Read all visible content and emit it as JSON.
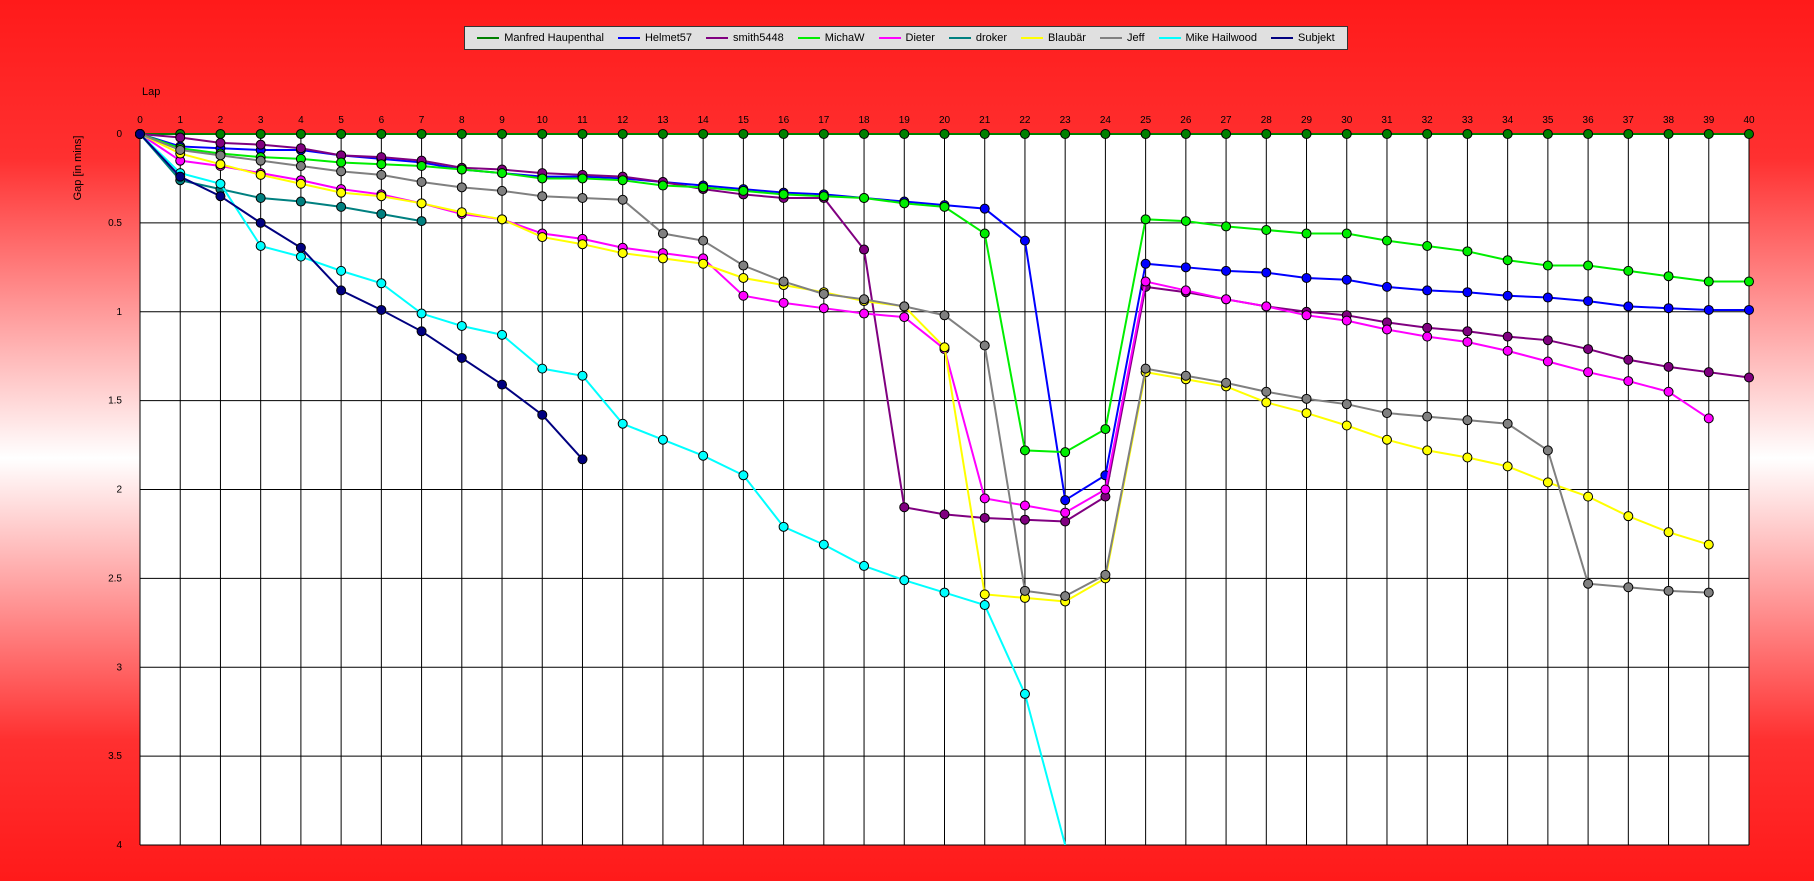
{
  "chart_data": {
    "type": "line",
    "xlabel": "Lap",
    "ylabel": "Gap [in mins]",
    "xlim": [
      0,
      40
    ],
    "ylim": [
      0,
      4
    ],
    "y_inverted": true,
    "grid": true,
    "legend_position": "top-center",
    "x": [
      0,
      1,
      2,
      3,
      4,
      5,
      6,
      7,
      8,
      9,
      10,
      11,
      12,
      13,
      14,
      15,
      16,
      17,
      18,
      19,
      20,
      21,
      22,
      23,
      24,
      25,
      26,
      27,
      28,
      29,
      30,
      31,
      32,
      33,
      34,
      35,
      36,
      37,
      38,
      39,
      40
    ],
    "y_ticks": [
      0,
      0.5,
      1,
      1.5,
      2,
      2.5,
      3,
      3.5,
      4
    ],
    "y_tick_labels": [
      "0",
      "0.5",
      "1",
      "1.5",
      "2",
      "2.5",
      "3",
      "3.5",
      "4"
    ],
    "series": [
      {
        "name": "Manfred Haupenthal",
        "color": "#008000",
        "values": [
          0,
          0,
          0,
          0,
          0,
          0,
          0,
          0,
          0,
          0,
          0,
          0,
          0,
          0,
          0,
          0,
          0,
          0,
          0,
          0,
          0,
          0,
          0,
          0,
          0,
          0,
          0,
          0,
          0,
          0,
          0,
          0,
          0,
          0,
          0,
          0,
          0,
          0,
          0,
          0,
          0
        ]
      },
      {
        "name": "Helmet57",
        "color": "#0000ff",
        "values": [
          0,
          0.07,
          0.08,
          0.09,
          0.09,
          0.12,
          0.14,
          0.16,
          0.2,
          0.22,
          0.24,
          0.24,
          0.25,
          0.27,
          0.29,
          0.31,
          0.33,
          0.34,
          0.36,
          0.38,
          0.4,
          0.42,
          0.6,
          2.06,
          1.92,
          0.73,
          0.75,
          0.77,
          0.78,
          0.81,
          0.82,
          0.86,
          0.88,
          0.89,
          0.91,
          0.92,
          0.94,
          0.97,
          0.98,
          0.99,
          0.99
        ]
      },
      {
        "name": "smith5448",
        "color": "#800080",
        "values": [
          0,
          0.02,
          0.05,
          0.06,
          0.08,
          0.12,
          0.13,
          0.15,
          0.19,
          0.2,
          0.22,
          0.23,
          0.24,
          0.27,
          0.31,
          0.34,
          0.36,
          0.36,
          0.65,
          2.1,
          2.14,
          2.16,
          2.17,
          2.18,
          2.04,
          0.86,
          0.89,
          0.93,
          0.97,
          1.0,
          1.02,
          1.06,
          1.09,
          1.11,
          1.14,
          1.16,
          1.21,
          1.27,
          1.31,
          1.34,
          1.37
        ]
      },
      {
        "name": "MichaW",
        "color": "#00ee00",
        "values": [
          0,
          0.08,
          0.11,
          0.13,
          0.14,
          0.16,
          0.17,
          0.18,
          0.2,
          0.22,
          0.25,
          0.25,
          0.26,
          0.29,
          0.3,
          0.32,
          0.34,
          0.35,
          0.36,
          0.39,
          0.41,
          0.56,
          1.78,
          1.79,
          1.66,
          0.48,
          0.49,
          0.52,
          0.54,
          0.56,
          0.56,
          0.6,
          0.63,
          0.66,
          0.71,
          0.74,
          0.74,
          0.77,
          0.8,
          0.83,
          0.83
        ]
      },
      {
        "name": "Dieter",
        "color": "#ff00ff",
        "values": [
          0,
          0.15,
          0.18,
          0.22,
          0.26,
          0.31,
          0.34,
          0.39,
          0.45,
          0.48,
          0.56,
          0.59,
          0.64,
          0.67,
          0.7,
          0.91,
          0.95,
          0.98,
          1.01,
          1.03,
          1.21,
          2.05,
          2.09,
          2.13,
          2.0,
          0.83,
          0.88,
          0.93,
          0.97,
          1.02,
          1.05,
          1.1,
          1.14,
          1.17,
          1.22,
          1.28,
          1.34,
          1.39,
          1.45,
          1.6
        ]
      },
      {
        "name": "droker",
        "color": "#008080",
        "values": [
          0,
          0.26,
          0.31,
          0.36,
          0.38,
          0.41,
          0.45,
          0.49
        ]
      },
      {
        "name": "Blaubär",
        "color": "#ffff00",
        "values": [
          0,
          0.11,
          0.17,
          0.23,
          0.28,
          0.33,
          0.35,
          0.39,
          0.44,
          0.48,
          0.58,
          0.62,
          0.67,
          0.7,
          0.73,
          0.81,
          0.85,
          0.89,
          0.94,
          0.97,
          1.2,
          2.59,
          2.61,
          2.63,
          2.5,
          1.34,
          1.38,
          1.42,
          1.51,
          1.57,
          1.64,
          1.72,
          1.78,
          1.82,
          1.87,
          1.96,
          2.04,
          2.15,
          2.24,
          2.31
        ]
      },
      {
        "name": "Jeff",
        "color": "#808080",
        "values": [
          0,
          0.09,
          0.12,
          0.15,
          0.18,
          0.21,
          0.23,
          0.27,
          0.3,
          0.32,
          0.35,
          0.36,
          0.37,
          0.56,
          0.6,
          0.74,
          0.83,
          0.9,
          0.93,
          0.97,
          1.02,
          1.19,
          2.57,
          2.6,
          2.48,
          1.32,
          1.36,
          1.4,
          1.45,
          1.49,
          1.52,
          1.57,
          1.59,
          1.61,
          1.63,
          1.78,
          2.53,
          2.55,
          2.57,
          2.58
        ]
      },
      {
        "name": "Mike Hailwood",
        "color": "#00ffff",
        "values": [
          0,
          0.22,
          0.28,
          0.63,
          0.69,
          0.77,
          0.84,
          1.01,
          1.08,
          1.13,
          1.32,
          1.36,
          1.63,
          1.72,
          1.81,
          1.92,
          2.21,
          2.31,
          2.43,
          2.51,
          2.58,
          2.65,
          3.15,
          4.0
        ]
      },
      {
        "name": "Subjekt",
        "color": "#000080",
        "values": [
          0,
          0.24,
          0.35,
          0.5,
          0.64,
          0.88,
          0.99,
          1.11,
          1.26,
          1.41,
          1.58,
          1.83
        ]
      }
    ]
  }
}
